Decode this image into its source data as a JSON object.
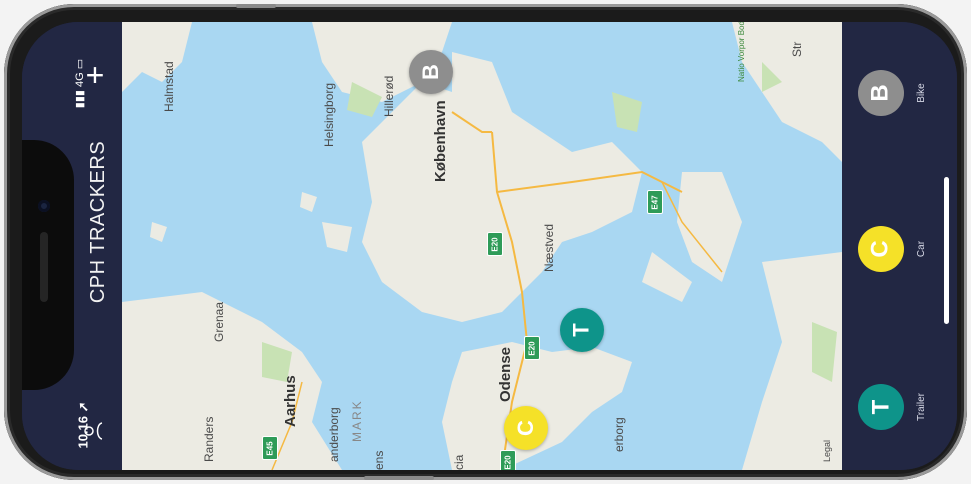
{
  "app": {
    "title": "CPH TRACKERS"
  },
  "status_bar": {
    "time": "10.16",
    "network": "4G"
  },
  "map": {
    "labels": [
      "Halmstad",
      "Helsingborg",
      "Hillerød",
      "København",
      "Næstved",
      "Grenaa",
      "Aarhus",
      "Randers",
      "Odense",
      "anderborg",
      "MARK",
      "ens",
      "cia",
      "erborg",
      "Legal",
      "Str",
      "Natio Vorpor Bodden"
    ],
    "road_badges": [
      "E20",
      "E20",
      "E47",
      "E45",
      "E20"
    ],
    "markers": [
      {
        "letter": "B",
        "type": "Bike",
        "color": "#8e8e8e"
      },
      {
        "letter": "T",
        "type": "Trailer",
        "color": "#0e948a"
      },
      {
        "letter": "C",
        "type": "Car",
        "color": "#f5e128"
      }
    ]
  },
  "trackers": [
    {
      "letter": "B",
      "label": "Bike",
      "color": "#8e8e8e"
    },
    {
      "letter": "C",
      "label": "Car",
      "color": "#f5e128"
    },
    {
      "letter": "T",
      "label": "Trailer",
      "color": "#0e948a"
    }
  ],
  "icons": {
    "add": "plus-icon",
    "location": "location-arrow-icon",
    "user": "user-icon",
    "signal": "signal-bars-icon",
    "battery": "battery-icon"
  }
}
